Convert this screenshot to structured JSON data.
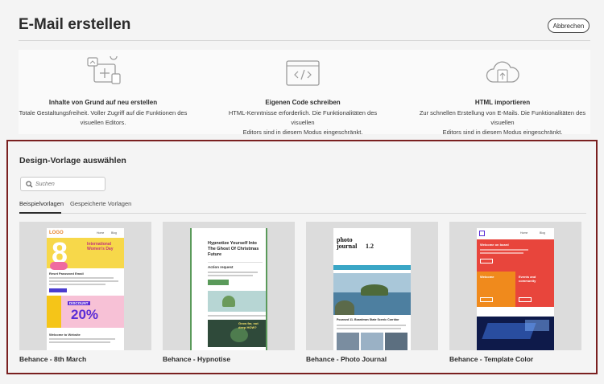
{
  "header": {
    "title": "E-Mail erstellen",
    "cancel_label": "Abbrechen"
  },
  "options": [
    {
      "icon": "design-from-scratch-icon",
      "title": "Inhalte von Grund auf neu erstellen",
      "desc1": "Totale Gestaltungsfreiheit. Voller Zugriff auf die Funktionen des",
      "desc2": "visuellen Editors."
    },
    {
      "icon": "code-icon",
      "title": "Eigenen Code schreiben",
      "desc1": "HTML-Kenntnisse erforderlich. Die Funktionalitäten des visuellen",
      "desc2": "Editors sind in diesem   Modus eingeschränkt."
    },
    {
      "icon": "cloud-upload-icon",
      "title": "HTML importieren",
      "desc1": "Zur schnellen Erstellung von E-Mails. Die Funktionalitäten des visuellen",
      "desc2": "Editors sind in diesem   Modus eingeschränkt."
    }
  ],
  "templates_panel": {
    "title": "Design-Vorlage auswählen",
    "search_placeholder": "Suchen",
    "tabs": [
      "Beispielvorlagen",
      "Gespeicherte Vorlagen"
    ],
    "active_tab": "Beispielvorlagen",
    "cards": [
      {
        "label": "Behance - 8th March",
        "logo": "LOGO",
        "nav": [
          "Home",
          "Blog"
        ],
        "heading": "International Women's Day",
        "big_number": "8",
        "section": "Reset Password Email",
        "discount_label": "DISCOUNT",
        "discount_value": "20%",
        "footer": "Welcome to Website"
      },
      {
        "label": "Behance - Hypnotise",
        "heading": "Hypnotize Yourself Into The Ghost Of Christmas Future",
        "section": "Action request",
        "caption": "Grow far, not deep HOW?"
      },
      {
        "label": "Behance - Photo Journal",
        "heading_line1": "photo",
        "heading_line2": "journal",
        "version": "1.2",
        "subtitle": "Issue 11, December 2021",
        "article": "Pounsed 11. Boardman State Scenic Corridor"
      },
      {
        "label": "Behance - Template Color",
        "nav": [
          "Home",
          "Blog"
        ],
        "hero": "Welcome on board",
        "block1": "Welcome",
        "block2": "Events and community"
      }
    ]
  },
  "colors": {
    "panel_border": "#7a2020",
    "accent_yellow": "#f5c518",
    "accent_pink": "#ef6aa0",
    "accent_purple": "#5a2dd6",
    "accent_green": "#5a9a5a",
    "accent_red": "#e8453c",
    "accent_orange": "#f08a1c",
    "accent_blue": "#3c6fd8"
  }
}
